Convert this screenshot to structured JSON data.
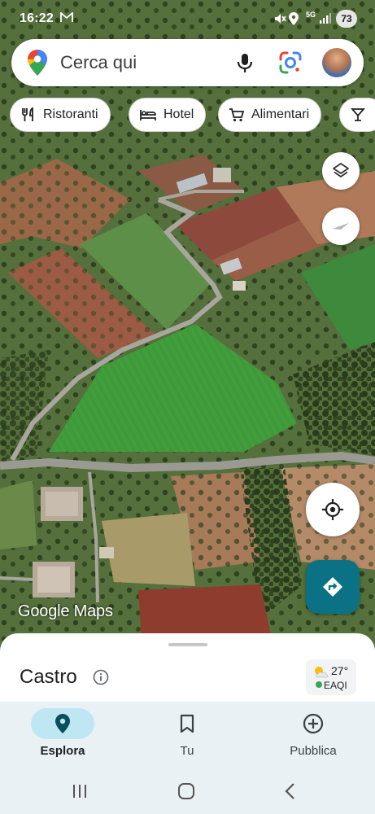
{
  "status_bar": {
    "time": "16:22",
    "network": "5G",
    "battery": "73"
  },
  "search": {
    "placeholder": "Cerca qui"
  },
  "chips": [
    {
      "label": "Ristoranti",
      "icon": "fork-knife-icon"
    },
    {
      "label": "Hotel",
      "icon": "bed-icon"
    },
    {
      "label": "Alimentari",
      "icon": "cart-icon"
    },
    {
      "label": "",
      "icon": "cocktail-icon"
    }
  ],
  "map": {
    "watermark": "Google Maps"
  },
  "place": {
    "name": "Castro"
  },
  "weather": {
    "temperature": "27°",
    "aqi_label": "EAQI"
  },
  "nav": {
    "explore": "Esplora",
    "you": "Tu",
    "contribute": "Pubblica"
  },
  "colors": {
    "accent": "#0b7285",
    "nav_background": "#eaf1f4",
    "active_pill": "#bfe6f3"
  }
}
